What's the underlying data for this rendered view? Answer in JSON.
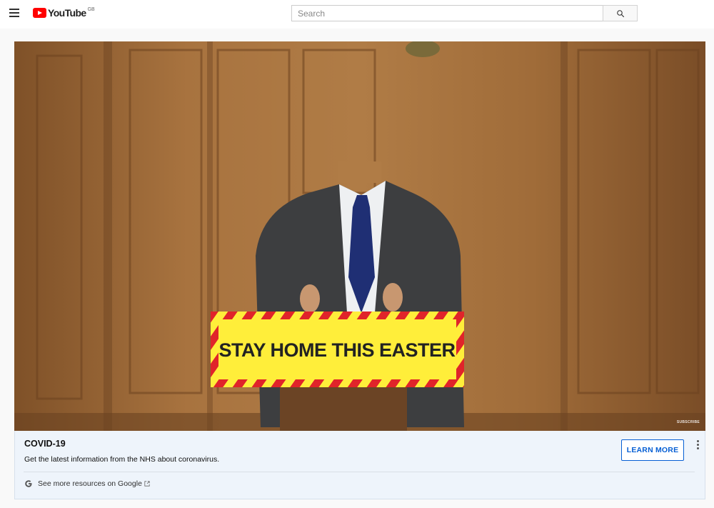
{
  "header": {
    "logo_text": "YouTube",
    "country_code": "GB",
    "search_placeholder": "Search"
  },
  "video": {
    "podium_sign": "STAY HOME THIS EASTER",
    "watermark": "SUBSCRIBE"
  },
  "info_panel": {
    "title": "COVID-19",
    "description": "Get the latest information from the NHS about coronavirus.",
    "learn_more_label": "LEARN MORE",
    "resources_link": "See more resources on Google"
  },
  "colors": {
    "youtube_red": "#ff0000",
    "link_blue": "#065fd4",
    "sign_yellow": "#ffee3a",
    "sign_red": "#e0242a"
  },
  "icons": [
    "menu-icon",
    "youtube-logo-icon",
    "search-icon",
    "kebab-menu-icon",
    "google-g-icon",
    "external-link-icon"
  ]
}
